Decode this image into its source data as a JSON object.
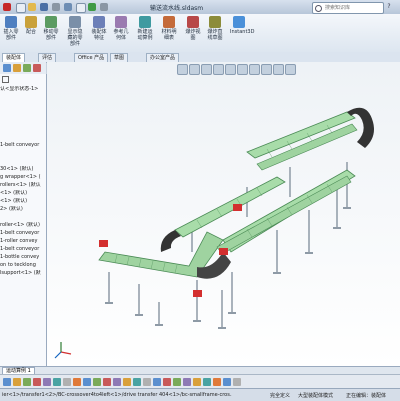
{
  "window": {
    "title": "输送流水线.sldasm"
  },
  "search": {
    "placeholder": "搜索知识库"
  },
  "ribbon": {
    "buttons": [
      {
        "label": "插入零部件",
        "icon": "insert-component-icon"
      },
      {
        "label": "配合",
        "icon": "mate-icon"
      },
      {
        "label": "移动零部件",
        "icon": "move-component-icon"
      },
      {
        "label": "显示隐藏的零部件",
        "icon": "show-hidden-icon"
      },
      {
        "label": "装配体特征",
        "icon": "assembly-feature-icon"
      },
      {
        "label": "参考几何体",
        "icon": "reference-geometry-icon"
      },
      {
        "label": "新建运动算例",
        "icon": "motion-study-icon"
      },
      {
        "label": "材料明细表",
        "icon": "bom-icon"
      },
      {
        "label": "爆炸视图",
        "icon": "exploded-view-icon"
      },
      {
        "label": "爆炸直线草图",
        "icon": "explode-line-icon"
      },
      {
        "label": "Instant3D",
        "icon": "instant3d-icon"
      }
    ]
  },
  "tabs": [
    {
      "label": "装配体"
    },
    {
      "label": "评估"
    },
    {
      "label": "Office 产品"
    },
    {
      "label": "草图"
    },
    {
      "label": "办公室产品"
    }
  ],
  "tree": {
    "items": [
      {
        "label": "认<显示状态-1>"
      },
      {
        "label": ""
      },
      {
        "label": ""
      },
      {
        "label": ""
      },
      {
        "label": ""
      },
      {
        "label": ""
      },
      {
        "label": ""
      },
      {
        "label": "1-belt conveyor"
      },
      {
        "label": ""
      },
      {
        "label": ""
      },
      {
        "label": "30<1> (默认)"
      },
      {
        "label": "g wrapper<1> ("
      },
      {
        "label": "rollers<1> (默认"
      },
      {
        "label": "<1> (默认)"
      },
      {
        "label": "<1> (默认)"
      },
      {
        "label": "2> (默认)"
      },
      {
        "label": ""
      },
      {
        "label": "roller<1> (默认)"
      },
      {
        "label": "1-belt conveyor"
      },
      {
        "label": "1-roller convey"
      },
      {
        "label": "1-belt conveyor"
      },
      {
        "label": "1-bottle convey"
      },
      {
        "label": "on to tecklong"
      },
      {
        "label": "lsupport<1> (默"
      }
    ]
  },
  "doc_tabs": [
    {
      "label": "运动算例 1"
    }
  ],
  "status": {
    "breadcrumb": "ier<1>/transfer1<2>/BC-crossover4to4left<1>/drive transfer 404<1>/bc-smallframe-cros...",
    "mode": "完全定义",
    "large_assembly": "大型装配体模式",
    "editing": "正在编辑：装配体"
  }
}
